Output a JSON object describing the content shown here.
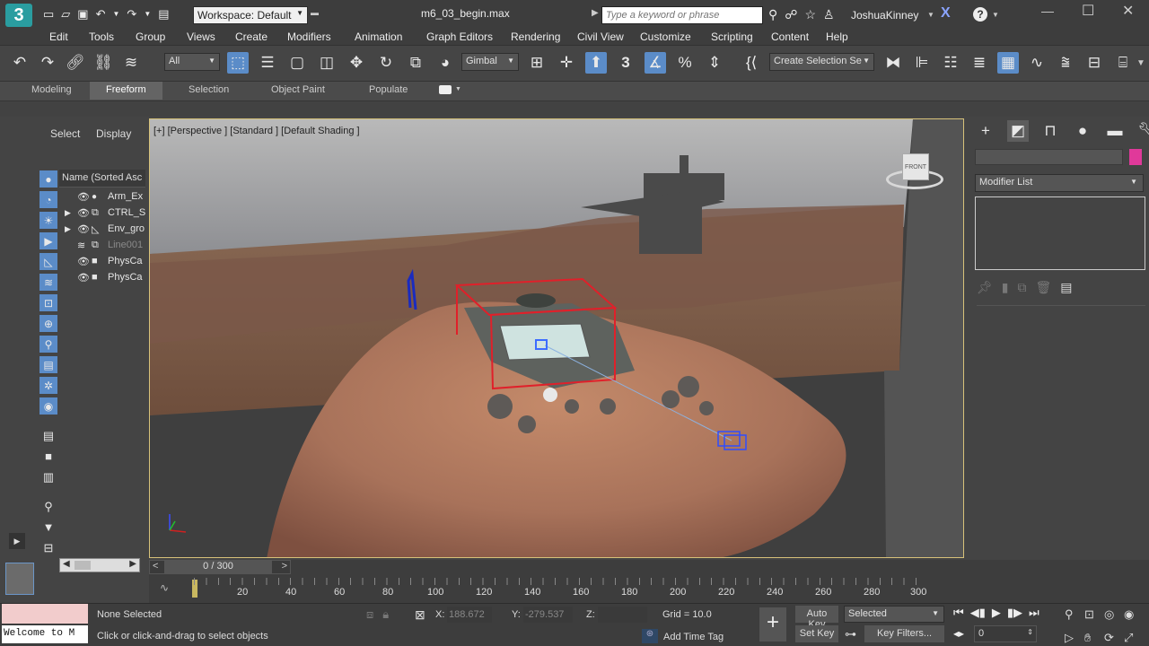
{
  "title_bar": {
    "workspace": "Workspace: Default",
    "file_name": "m6_03_begin.max",
    "search_placeholder": "Type a keyword or phrase",
    "username": "JoshuaKinney"
  },
  "menu": [
    "Edit",
    "Tools",
    "Group",
    "Views",
    "Create",
    "Modifiers",
    "Animation",
    "Graph Editors",
    "Rendering",
    "Civil View",
    "Customize",
    "Scripting",
    "Content",
    "Help"
  ],
  "toolbar": {
    "filter": "All",
    "coordinate_system": "Gimbal",
    "selection_set": "Create Selection Se"
  },
  "ribbon_tabs": [
    "Modeling",
    "Freeform",
    "Selection",
    "Object Paint",
    "Populate"
  ],
  "ribbon_active": "Freeform",
  "scene_explorer": {
    "tabs": [
      "Select",
      "Display"
    ],
    "column_header": "Name (Sorted Asc",
    "items": [
      {
        "name": "Arm_Ex",
        "expandable": false,
        "dim": false
      },
      {
        "name": "CTRL_S",
        "expandable": true,
        "dim": false
      },
      {
        "name": "Env_gro",
        "expandable": true,
        "dim": false
      },
      {
        "name": "Line001",
        "expandable": false,
        "dim": true
      },
      {
        "name": "PhysCa",
        "expandable": false,
        "dim": false
      },
      {
        "name": "PhysCa",
        "expandable": false,
        "dim": false
      }
    ]
  },
  "viewport": {
    "label": "[+] [Perspective ] [Standard ] [Default Shading ]",
    "viewcube_face": "FRONT"
  },
  "command_panel": {
    "modifier_list": "Modifier List"
  },
  "timeline": {
    "frame_display": "0 / 300",
    "ticks": [
      "20",
      "40",
      "60",
      "80",
      "100",
      "120",
      "140",
      "160",
      "180",
      "200",
      "220",
      "240",
      "260",
      "280",
      "300"
    ]
  },
  "status": {
    "script_listener": "Welcome to M",
    "selection_status": "None Selected",
    "prompt": "Click or click-and-drag to select objects",
    "x_label": "X:",
    "x_value": "188.672",
    "y_label": "Y:",
    "y_value": "-279.537",
    "z_label": "Z:",
    "grid": "Grid = 10.0",
    "add_time_tag": "Add Time Tag",
    "auto_key": "Auto Key",
    "set_key": "Set Key",
    "key_mode": "Selected",
    "key_filters": "Key Filters...",
    "current_frame": "0"
  },
  "colors": {
    "accent": "#5b8cc8",
    "viewport_border": "#d7c27a",
    "swatch": "#e0399a"
  }
}
